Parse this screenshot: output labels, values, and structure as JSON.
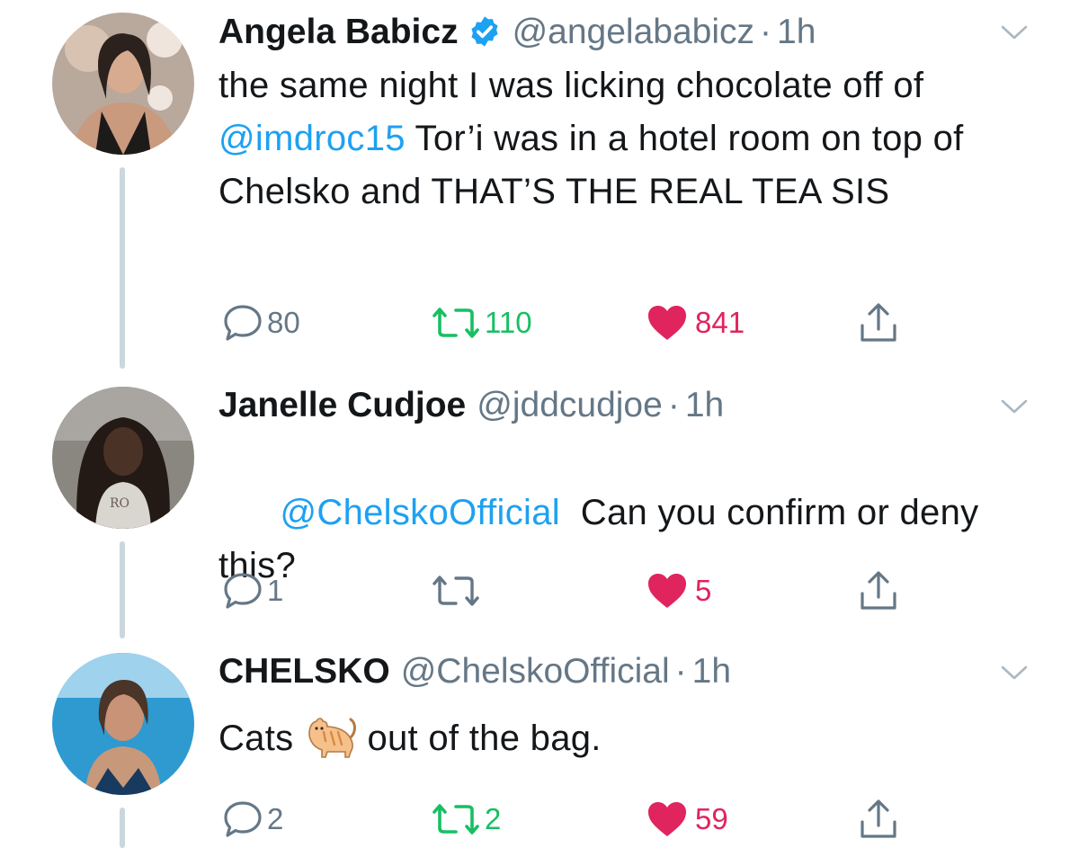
{
  "tweets": [
    {
      "name": "Angela Babicz",
      "verified": true,
      "handle": "@angelababicz",
      "separator": "·",
      "time": "1h",
      "text_parts": [
        {
          "type": "text",
          "value": "the same night I was licking chocolate off of "
        },
        {
          "type": "mention",
          "value": "@imdroc15"
        },
        {
          "type": "text",
          "value": " Tor’i was in a hotel room on top of Chelsko and THAT’S THE REAL TEA SIS"
        }
      ],
      "replies": "80",
      "retweets": "110",
      "likes": "841",
      "liked": true,
      "retweet_active": true,
      "avatar_palette": [
        "#3a2f2a",
        "#c99a7e",
        "#e9d3c3"
      ]
    },
    {
      "name": "Janelle Cudjoe",
      "verified": false,
      "handle": "@jddcudjoe",
      "separator": "·",
      "time": "1h",
      "text_parts": [
        {
          "type": "mention",
          "value": "@ChelskoOfficial"
        },
        {
          "type": "text",
          "value": "  Can you confirm or deny this?"
        }
      ],
      "replies": "1",
      "retweets": "",
      "likes": "5",
      "liked": true,
      "retweet_active": false,
      "avatar_palette": [
        "#6e6a63",
        "#3b2a22",
        "#d8d4cf"
      ]
    },
    {
      "name": "CHELSKO",
      "verified": false,
      "handle": "@ChelskoOfficial",
      "separator": "·",
      "time": "1h",
      "text_parts": [
        {
          "type": "text",
          "value": "Cats"
        },
        {
          "type": "emoji",
          "value": "cat-emoji"
        },
        {
          "type": "text",
          "value": "out of the bag."
        }
      ],
      "replies": "2",
      "retweets": "2",
      "likes": "59",
      "liked": true,
      "retweet_active": true,
      "avatar_palette": [
        "#2e9ad0",
        "#c8987a",
        "#173a5e"
      ]
    }
  ],
  "colors": {
    "mention": "#1da1f2",
    "like": "#e0245e",
    "retweet": "#17bf63",
    "muted": "#657786",
    "verified": "#1da1f2",
    "thread_line": "#ccd6dd"
  },
  "icons": {
    "reply": "speech-bubble-icon",
    "retweet": "retweet-arrows-icon",
    "like": "heart-icon",
    "share": "share-upload-icon",
    "menu": "chevron-down-icon",
    "verified": "verified-badge-icon"
  }
}
